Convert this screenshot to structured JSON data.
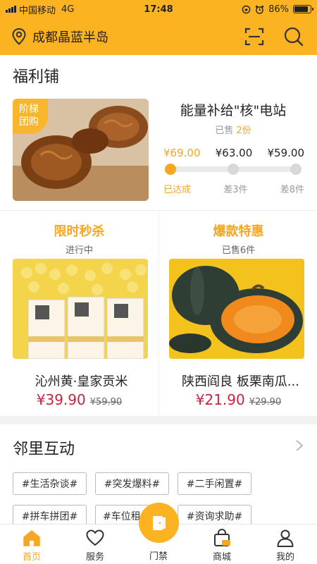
{
  "status_bar": {
    "carrier": "中国移动",
    "network": "4G",
    "time": "17:48",
    "battery_percent": "86%",
    "battery_level": 0.86
  },
  "header": {
    "location": "成都晶蓝半岛",
    "icons": [
      "location-pin-icon",
      "scan-icon",
      "search-icon"
    ],
    "bg_color": "#fcb322"
  },
  "welfare": {
    "title": "福利铺",
    "group_buy": {
      "badge_line1": "阶梯",
      "badge_line2": "团购",
      "product_name": "能量补给\"核\"电站",
      "sold_label": "已售",
      "sold_count": "2份",
      "tier_prices": [
        "¥69.00",
        "¥63.00",
        "¥59.00"
      ],
      "tier_status": [
        "已达成",
        "差3件",
        "差8件"
      ],
      "tiers_reached": 1
    },
    "flash_sale": {
      "tag": "限时秒杀",
      "sub": "进行中",
      "product_name": "沁州黄·皇家贡米",
      "price": "¥39.90",
      "original_price": "¥59.90"
    },
    "hot_deal": {
      "tag": "爆款特惠",
      "sub": "已售6件",
      "product_name": "陕西阎良 板栗南瓜...",
      "price": "¥21.90",
      "original_price": "¥29.90"
    }
  },
  "neighbor": {
    "title": "邻里互动",
    "tags": [
      "#生活杂谈#",
      "#突发爆料#",
      "#二手闲置#",
      "#拼车拼团#",
      "#车位租",
      "#资询求助#"
    ]
  },
  "tab_bar": {
    "items": [
      {
        "label": "首页",
        "icon": "home-icon",
        "active": true
      },
      {
        "label": "服务",
        "icon": "heart-icon",
        "active": false
      },
      {
        "label": "门禁",
        "icon": "door-icon",
        "active": false
      },
      {
        "label": "商城",
        "icon": "shopping-bag-icon",
        "active": false
      },
      {
        "label": "我的",
        "icon": "person-icon",
        "active": false
      }
    ],
    "active_color": "#f5a623"
  },
  "colors": {
    "accent": "#fcb322",
    "price_red": "#c8243e"
  }
}
